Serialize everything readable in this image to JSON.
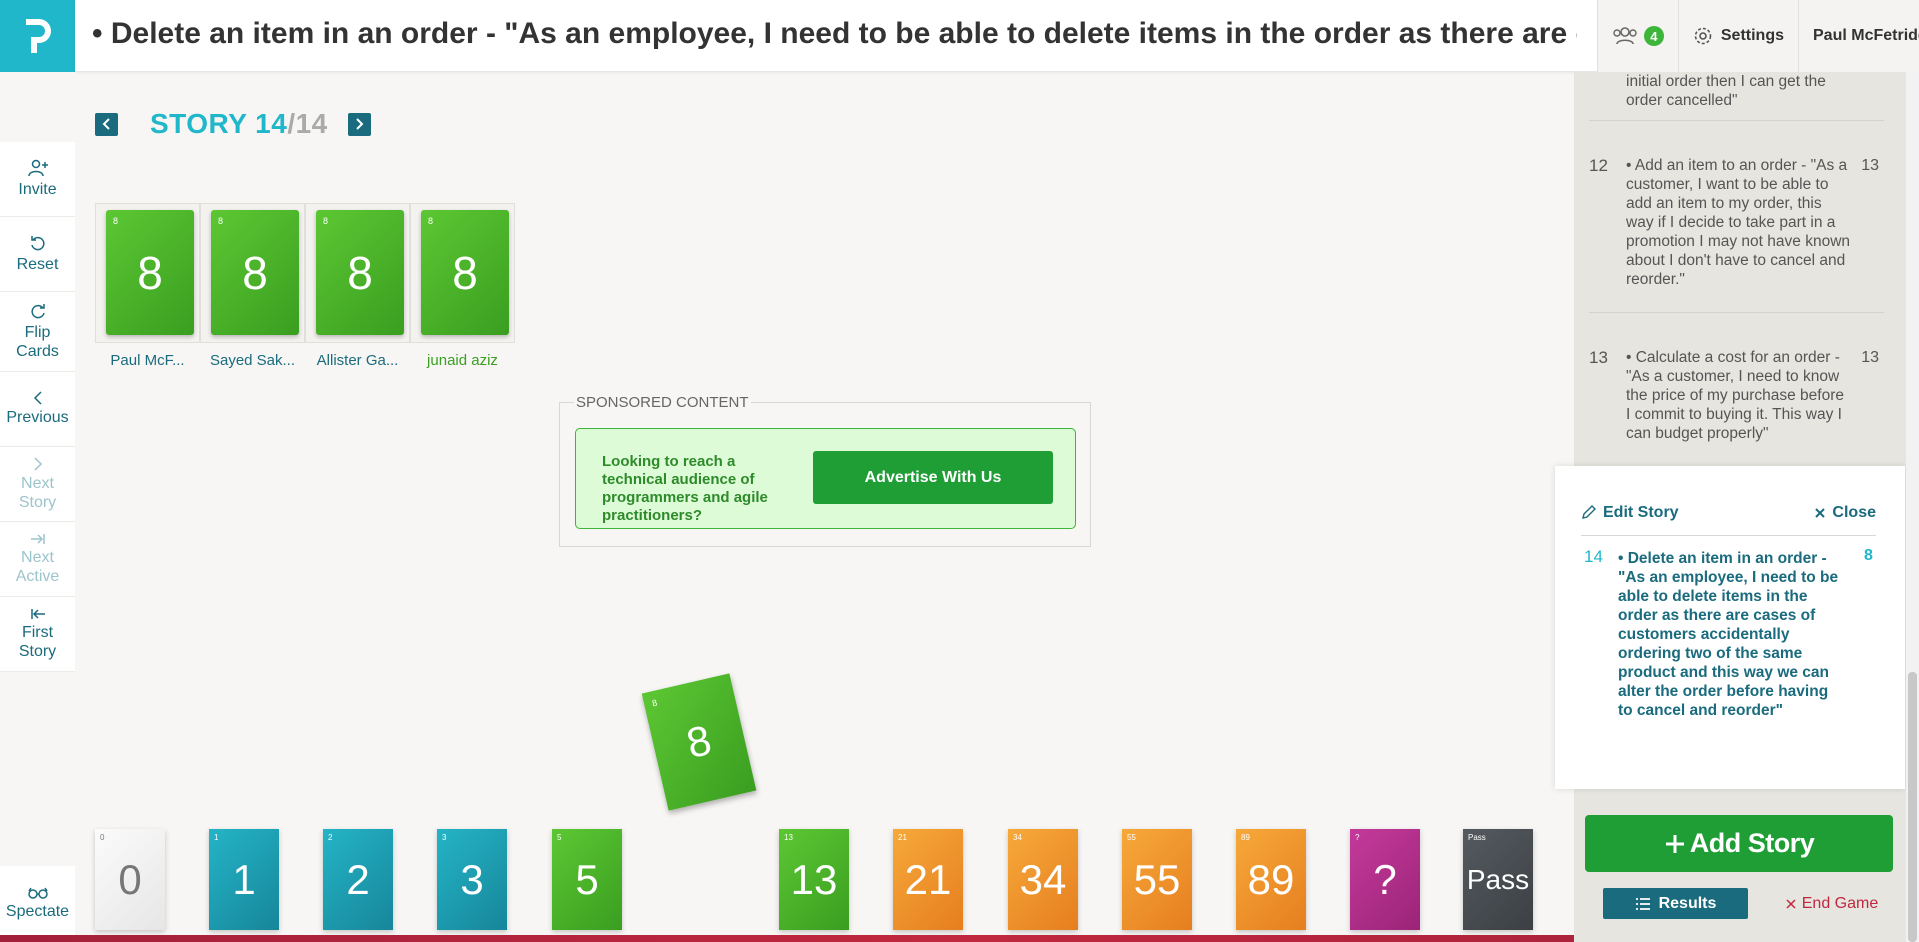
{
  "header": {
    "title": "• Delete an item in an order - \"As an employee, I need to be able to delete items in the order as there are cases of customers accidentally ordering two of the same product and this way we can alter the order before having to cancel and reorder\"",
    "players_count": "4",
    "settings_label": "Settings",
    "user_name": "Paul McFetridge"
  },
  "sidebar": {
    "invite": "Invite",
    "reset": "Reset",
    "flip_cards": "Flip Cards",
    "previous": "Previous",
    "next_story": "Next Story",
    "next_active": "Next Active",
    "first_story": "First Story",
    "spectate": "Spectate"
  },
  "story_nav": {
    "label": "STORY 14",
    "total": "/14"
  },
  "played_cards": [
    {
      "player": "Paul McF...",
      "value": "8"
    },
    {
      "player": "Sayed Sak...",
      "value": "8"
    },
    {
      "player": "Allister Ga...",
      "value": "8"
    },
    {
      "player": "junaid aziz",
      "value": "8"
    }
  ],
  "sponsored": {
    "label": "SPONSORED CONTENT",
    "text": "Looking to reach a technical audience of programmers and agile practitioners?",
    "button": "Advertise With Us"
  },
  "selected_card": "8",
  "deck": [
    "0",
    "1",
    "2",
    "3",
    "5",
    "13",
    "21",
    "34",
    "55",
    "89",
    "?",
    "Pass"
  ],
  "stories": [
    {
      "text": "initial order then I can get the order cancelled\""
    },
    {
      "num": "12",
      "text": "• Add an item to an order - \"As a customer, I want to be able to add an item to my order, this way if I decide to take part in a promotion I may not have known about I don't have to cancel and reorder.\"",
      "points": "13"
    },
    {
      "num": "13",
      "text": "• Calculate a cost for an order - \"As a customer, I need to know the price of my purchase before I commit to buying it. This way I can budget properly\"",
      "points": "13"
    }
  ],
  "edit_panel": {
    "edit_label": "Edit Story",
    "close_label": "Close",
    "num": "14",
    "text": "• Delete an item in an order - \"As an employee, I need to be able to delete items in the order as there are cases of customers accidentally ordering two of the same product and this way we can alter the order before having to cancel and reorder\"",
    "points": "8"
  },
  "actions": {
    "add_story": "Add Story",
    "results": "Results",
    "end_game": "End Game"
  },
  "colors": {
    "accent_teal": "#1fb7c9",
    "dark_teal": "#1a6b7d",
    "green": "#1f9e35",
    "end_game_red": "#c0283f"
  }
}
